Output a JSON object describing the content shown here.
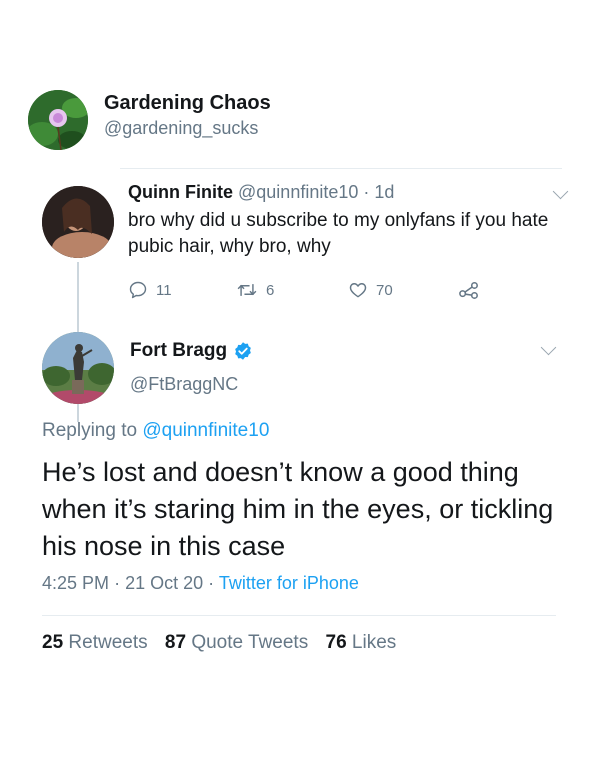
{
  "profile": {
    "name": "Gardening Chaos",
    "handle": "@gardening_sucks"
  },
  "reply_tweet": {
    "name": "Quinn Finite",
    "handle": "@quinnfinite10",
    "separator": "·",
    "age": "1d",
    "text": "bro why did u subscribe to my onlyfans if you hate pubic hair, why bro, why",
    "actions": {
      "reply_count": "11",
      "retweet_count": "6",
      "like_count": "70"
    }
  },
  "main_tweet": {
    "name": "Fort Bragg",
    "handle": "@FtBraggNC",
    "replying_prefix": "Replying to",
    "replying_handle": "@quinnfinite10",
    "text": "He’s lost and doesn’t know a good thing when it’s staring him in the eyes, or tickling his nose in this case",
    "time": "4:25 PM",
    "date": "21 Oct 20",
    "dot": "·",
    "source": "Twitter for iPhone"
  },
  "stats": {
    "retweets_count": "25",
    "retweets_label": "Retweets",
    "quotes_count": "87",
    "quotes_label": "Quote Tweets",
    "likes_count": "76",
    "likes_label": "Likes"
  },
  "colors": {
    "accent": "#1da1f2",
    "secondary_text": "#657786",
    "primary_text": "#14171a",
    "divider": "#e6ecf0"
  }
}
